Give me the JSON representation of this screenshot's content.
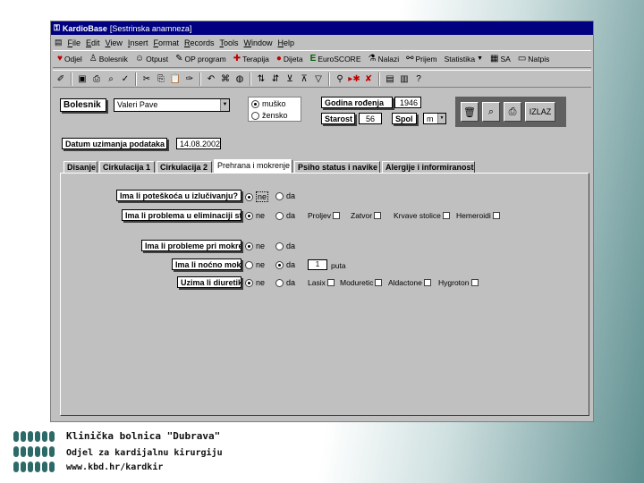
{
  "window": {
    "title": "KardioBase",
    "subtitle": "[Sestrinska anamneza]"
  },
  "menu": [
    "File",
    "Edit",
    "View",
    "Insert",
    "Format",
    "Records",
    "Tools",
    "Window",
    "Help"
  ],
  "toolbar1": {
    "odjel": "Odjel",
    "bolesnik": "Bolesnik",
    "otpust": "Otpust",
    "op_program": "OP program",
    "terapija": "Terapija",
    "dijeta": "Dijeta",
    "euroscore": "EuroSCORE",
    "nalazi": "Nalazi",
    "prijem": "Prijem",
    "statistika": "Statistika",
    "sa": "SA",
    "natpis": "Natpis"
  },
  "form": {
    "bolesnik_label": "Bolesnik",
    "bolesnik_value": "Valeri Pave",
    "sex_options": [
      "muško",
      "žensko"
    ],
    "godina_label": "Godina rođenja",
    "godina_value": "1946",
    "starost_label": "Starost",
    "starost_value": "56",
    "spol_label": "Spol",
    "spol_value": "m",
    "izlaz": "IZLAZ",
    "datum_label": "Datum uzimanja podataka",
    "datum_value": "14.08.2002"
  },
  "tabs": [
    "Disanje",
    "Cirkulacija 1",
    "Cirkulacija 2",
    "Prehrana i mokrenje",
    "Psiho status i navike",
    "Alergije i informiranost"
  ],
  "questions": {
    "q1": "Ima li poteškoća u izlučivanju?",
    "q2": "Ima li problema u eliminaciji stolice?",
    "q3": "Ima li probleme pri mokrenju?",
    "q4": "Ima li noćno mokrenje?",
    "q5": "Uzima li diuretike?",
    "ne": "ne",
    "da": "da"
  },
  "q2_checks": [
    "Proljev",
    "Zatvor",
    "Krvave stolice",
    "Hemeroidi"
  ],
  "q4_count": "1",
  "q4_unit": "puta",
  "q5_checks": [
    "Lasix",
    "Moduretic",
    "Aldactone",
    "Hygroton"
  ],
  "footer": {
    "line1": "Klinička bolnica \"Dubrava\"",
    "line2": "Odjel za kardijalnu kirurgiju",
    "line3": "www.kbd.hr/kardkir"
  },
  "colors": {
    "titlebar": "#000080",
    "window_bg": "#c0c0c0",
    "footer_logo": "#2d6a67"
  }
}
